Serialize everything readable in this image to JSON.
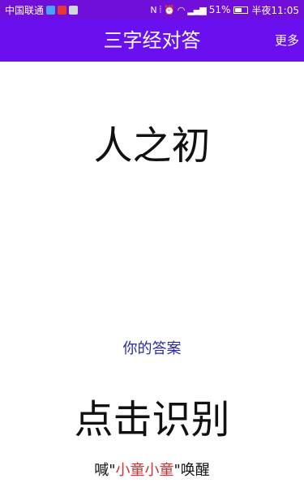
{
  "status_bar": {
    "carrier": "中国联通",
    "battery": "51%",
    "time": "半夜11:05"
  },
  "app_bar": {
    "title": "三字经对答",
    "more_label": "更多"
  },
  "main": {
    "question": "人之初",
    "answer_label": "你的答案",
    "recognize_prompt": "点击识别",
    "wake_hint": {
      "prefix": "喊\"",
      "wake_word": "小童小童",
      "suffix": "\"唤醒"
    }
  },
  "colors": {
    "status_bar_bg": "#6f0fd9",
    "app_bar_bg": "#6a10f0",
    "answer_label": "#2a2aa8",
    "wake_word": "#d32f2f"
  }
}
